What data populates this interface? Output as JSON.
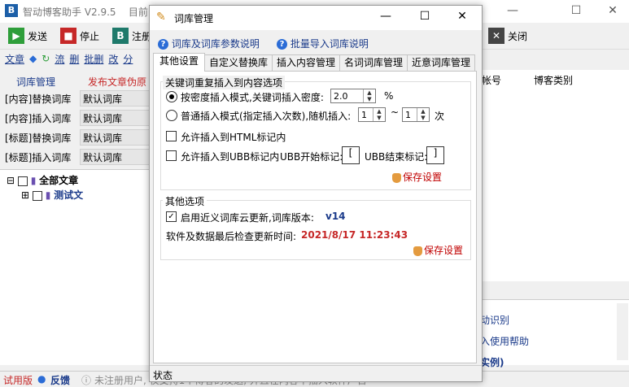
{
  "main": {
    "title": "智动博客助手 V2.9.5",
    "title_suffix": "目前",
    "window_controls": [
      "—",
      "☐",
      "✕"
    ],
    "toolbar": {
      "send": "发送",
      "stop": "停止",
      "register": "注册",
      "close": "关闭"
    },
    "menu": [
      "文章",
      "流",
      "删",
      "批删",
      "改",
      "分"
    ],
    "left_tabs": [
      "词库管理",
      "发布文章伪原"
    ],
    "left_rows": [
      {
        "label": "[内容]替换词库",
        "value": "默认词库"
      },
      {
        "label": "[内容]插入词库",
        "value": "默认词库"
      },
      {
        "label": "[标题]替换词库",
        "value": "默认词库"
      },
      {
        "label": "[标题]插入词库",
        "value": "默认词库"
      }
    ],
    "tree": {
      "root": "全部文章",
      "child": "测试文"
    },
    "right_columns": [
      "帐号",
      "博客类别"
    ],
    "right_lower": [
      "动识别",
      "入使用帮助",
      "实例)"
    ],
    "status": {
      "trial": "试用版",
      "feedback": "反馈",
      "notice": "未注册用户, 仅支持1个博客的发送, 并且在内容中插入软件广告"
    }
  },
  "dialog": {
    "title": "词库管理",
    "links": {
      "help1": "词库及词库参数说明",
      "help2": "批量导入词库说明"
    },
    "tabs": [
      "其他设置",
      "自定义替换库",
      "插入内容管理",
      "名词词库管理",
      "近意词库管理"
    ],
    "active_tab": 0,
    "group1": {
      "title": "关键词重复插入到内容选项",
      "mode1_label": "按密度插入模式,关键词插入密度:",
      "mode1_value": "2.0",
      "mode1_unit": "%",
      "mode1_selected": true,
      "mode2_label": "普通插入模式(指定插入次数),随机插入:",
      "mode2_min": "1",
      "mode2_sep": "~",
      "mode2_max": "1",
      "mode2_unit": "次",
      "html_label": "允许插入到HTML标记内",
      "html_checked": false,
      "ubb_label": "允许插入到UBB标记内",
      "ubb_checked": false,
      "ubb_start_label": "UBB开始标记:",
      "ubb_start_value": "[",
      "ubb_end_label": "UBB结束标记:",
      "ubb_end_value": "]",
      "save": "保存设置"
    },
    "group2": {
      "title": "其他选项",
      "cloud_label": "启用近义词库云更新,词库版本:",
      "cloud_checked": true,
      "cloud_version": "v14",
      "update_label": "软件及数据最后检查更新时间:",
      "update_time": "2021/8/17 11:23:43",
      "save": "保存设置"
    },
    "status": "状态",
    "window_controls": [
      "—",
      "☐",
      "✕"
    ]
  }
}
